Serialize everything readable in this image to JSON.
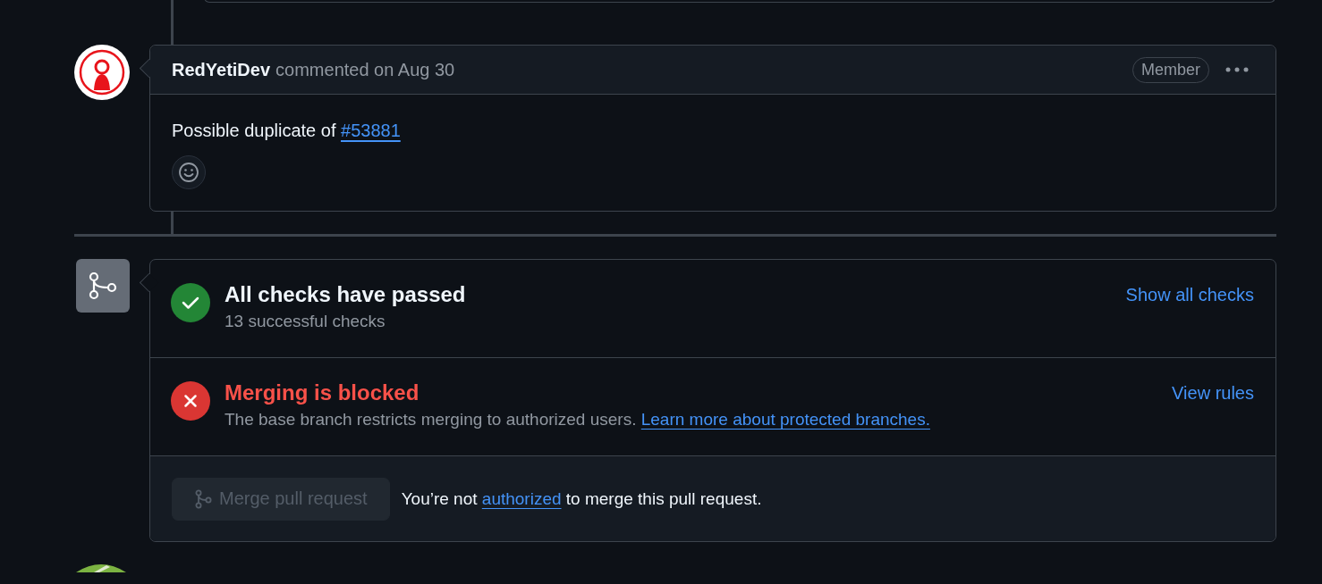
{
  "comment": {
    "author": "RedYetiDev",
    "meta": "commented on Aug 30",
    "role": "Member",
    "body": {
      "text": "Possible duplicate of",
      "link": "#53881"
    }
  },
  "checks": [
    {
      "kind": "success",
      "title": "All checks have passed",
      "description": "13 successful checks",
      "action": "Show all checks"
    },
    {
      "kind": "failure",
      "title": "Merging is blocked",
      "description": "The base branch restricts merging to authorized users.",
      "link": "Learn more about protected branches.",
      "action": "View rules"
    }
  ],
  "merge": {
    "button": "Merge pull request",
    "disabled": true,
    "message_before": "You’re not",
    "message_link": "authorized",
    "message_after": "to merge this pull request."
  }
}
